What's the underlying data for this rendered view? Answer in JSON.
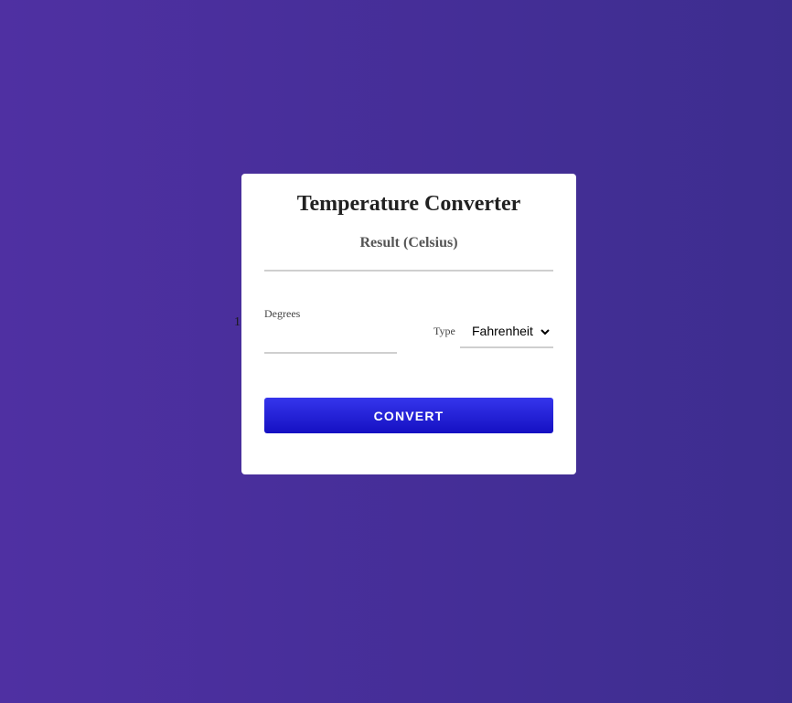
{
  "stray_char": "1",
  "converter": {
    "title": "Temperature Converter",
    "result_label": "Result (Celsius)",
    "degrees_label": "Degrees",
    "degrees_value": "",
    "type_label": "Type",
    "type_selected": "Fahrenheit",
    "convert_label": "CONVERT"
  },
  "icons": {
    "select_chevron": "chevron-down-icon"
  },
  "colors": {
    "background_start": "#4f30a2",
    "background_end": "#3d2d8f",
    "button_start": "#3535ec",
    "button_end": "#1510c2"
  }
}
